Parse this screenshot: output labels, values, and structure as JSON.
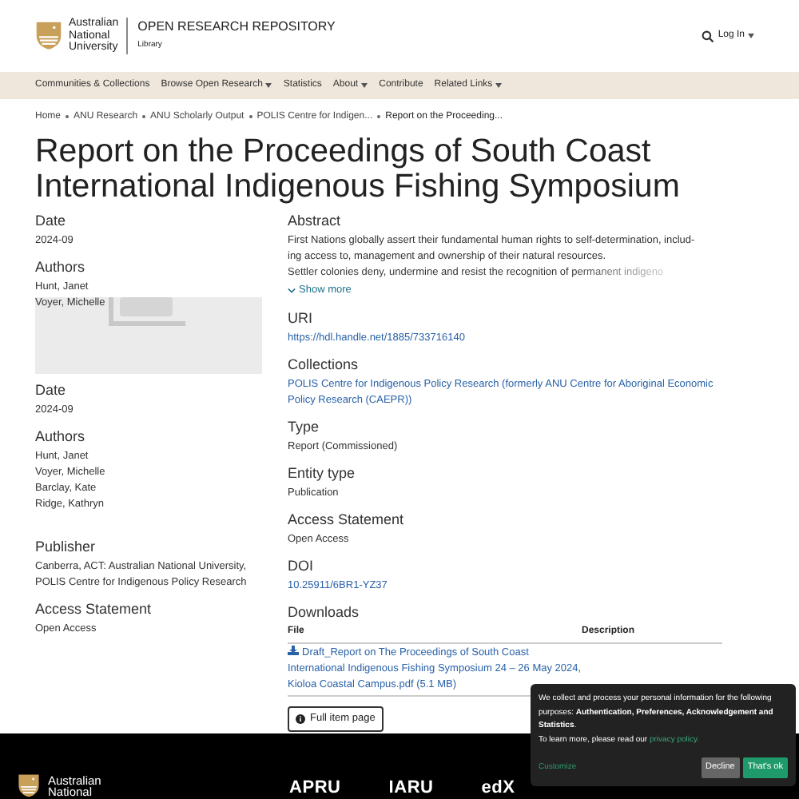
{
  "header": {
    "university": [
      "Australian",
      "National",
      "University"
    ],
    "repository": "OPEN RESEARCH REPOSITORY",
    "library": "Library",
    "login": "Log In"
  },
  "nav": [
    {
      "label": "Communities & Collections",
      "dropdown": false
    },
    {
      "label": "Browse Open Research",
      "dropdown": true
    },
    {
      "label": "Statistics",
      "dropdown": false
    },
    {
      "label": "About",
      "dropdown": true
    },
    {
      "label": "Contribute",
      "dropdown": false
    },
    {
      "label": "Related Links",
      "dropdown": true
    }
  ],
  "breadcrumb": [
    {
      "label": "Home",
      "current": false
    },
    {
      "label": "ANU Research",
      "current": false
    },
    {
      "label": "ANU Scholarly Output",
      "current": false
    },
    {
      "label": "POLIS Centre for Indigen...",
      "current": false
    },
    {
      "label": "Report on the Proceeding...",
      "current": true
    }
  ],
  "title": "Report on the Proceedings of South Coast International Indigenous Fishing Symposium",
  "left_top": [
    {
      "label": "Date",
      "values": [
        "2024-09"
      ]
    },
    {
      "label": "Authors",
      "values": [
        "Hunt, Janet",
        "Voyer, Michelle"
      ]
    }
  ],
  "left": [
    {
      "label": "Date",
      "values": [
        "2024-09"
      ]
    },
    {
      "label": "Authors",
      "values": [
        "Hunt, Janet",
        "Voyer, Michelle",
        "Barclay, Kate",
        "Ridge, Kathryn"
      ]
    },
    {
      "label": "Publisher",
      "values": [
        "Canberra, ACT: Australian National University, POLIS Centre for Indigenous Policy Research"
      ]
    },
    {
      "label": "Access Statement",
      "values": [
        "Open Access"
      ]
    }
  ],
  "abstract": {
    "label": "Abstract",
    "lines": [
      "First Nations globally assert their fundamental human rights to self-determination, includ-ing access to, management and ownership of their natural resources.",
      "Settler colonies deny, undermine and resist the recognition of permanent indigeno"
    ],
    "show_more": "Show more"
  },
  "right": [
    {
      "label": "URI",
      "kind": "link",
      "value": "https://hdl.handle.net/1885/733716140"
    },
    {
      "label": "Collections",
      "kind": "link",
      "value": "POLIS Centre for Indigenous Policy Research (formerly ANU Centre for Aboriginal Economic Policy Research (CAEPR))"
    },
    {
      "label": "Type",
      "kind": "text",
      "value": "Report (Commissioned)"
    },
    {
      "label": "Entity type",
      "kind": "text",
      "value": "Publication"
    },
    {
      "label": "Access Statement",
      "kind": "text",
      "value": "Open Access"
    },
    {
      "label": "DOI",
      "kind": "link",
      "value": "10.25911/6BR1-YZ37"
    }
  ],
  "downloads": {
    "label": "Downloads",
    "columns": [
      "File",
      "Description"
    ],
    "files": [
      "Draft_Report on The Proceedings of South Coast International Indigenous Fishing Symposium 24 – 26 May 2024, Kioloa Coastal Campus.pdf (5.1 MB)"
    ]
  },
  "full_item_button": "Full item page",
  "footer": {
    "university": [
      "Australian",
      "National"
    ],
    "partners": [
      "APRU",
      "IARU",
      "edX"
    ]
  },
  "cookie": {
    "text": "We collect and process your personal information for the following purposes: **Authentication, Preferences, Acknowledgement and Statistics**.",
    "learn": "To learn more, please read our",
    "link": "privacy policy.",
    "customize": "Customize",
    "decline": "Decline",
    "accept": "That's ok"
  }
}
